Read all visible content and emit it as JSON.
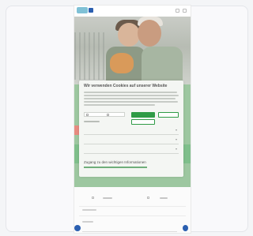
{
  "cookie_dialog": {
    "title": "Wir verwenden Cookies auf unserer Website",
    "subtitle": "Zugang zu den wichtigen Informationen"
  },
  "colors": {
    "accent": "#2f9b46",
    "brand_blue": "#2b5fb0",
    "logo_teal": "#7fc1d6"
  },
  "icons": [
    "menu-icon",
    "search-icon",
    "chevron-down-icon",
    "chat-icon",
    "help-icon"
  ]
}
